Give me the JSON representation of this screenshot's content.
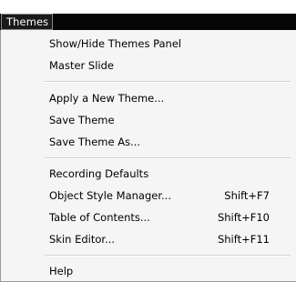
{
  "menubar": {
    "active_menu": "Themes"
  },
  "menu": {
    "items": [
      {
        "label": "Show/Hide Themes Panel",
        "shortcut": ""
      },
      {
        "label": "Master Slide",
        "shortcut": ""
      },
      {
        "label": "Apply a New Theme...",
        "shortcut": ""
      },
      {
        "label": "Save Theme",
        "shortcut": ""
      },
      {
        "label": "Save Theme As...",
        "shortcut": ""
      },
      {
        "label": "Recording Defaults",
        "shortcut": ""
      },
      {
        "label": "Object Style Manager...",
        "shortcut": "Shift+F7"
      },
      {
        "label": "Table of Contents...",
        "shortcut": "Shift+F10"
      },
      {
        "label": "Skin Editor...",
        "shortcut": "Shift+F11"
      },
      {
        "label": "Help",
        "shortcut": ""
      }
    ]
  }
}
